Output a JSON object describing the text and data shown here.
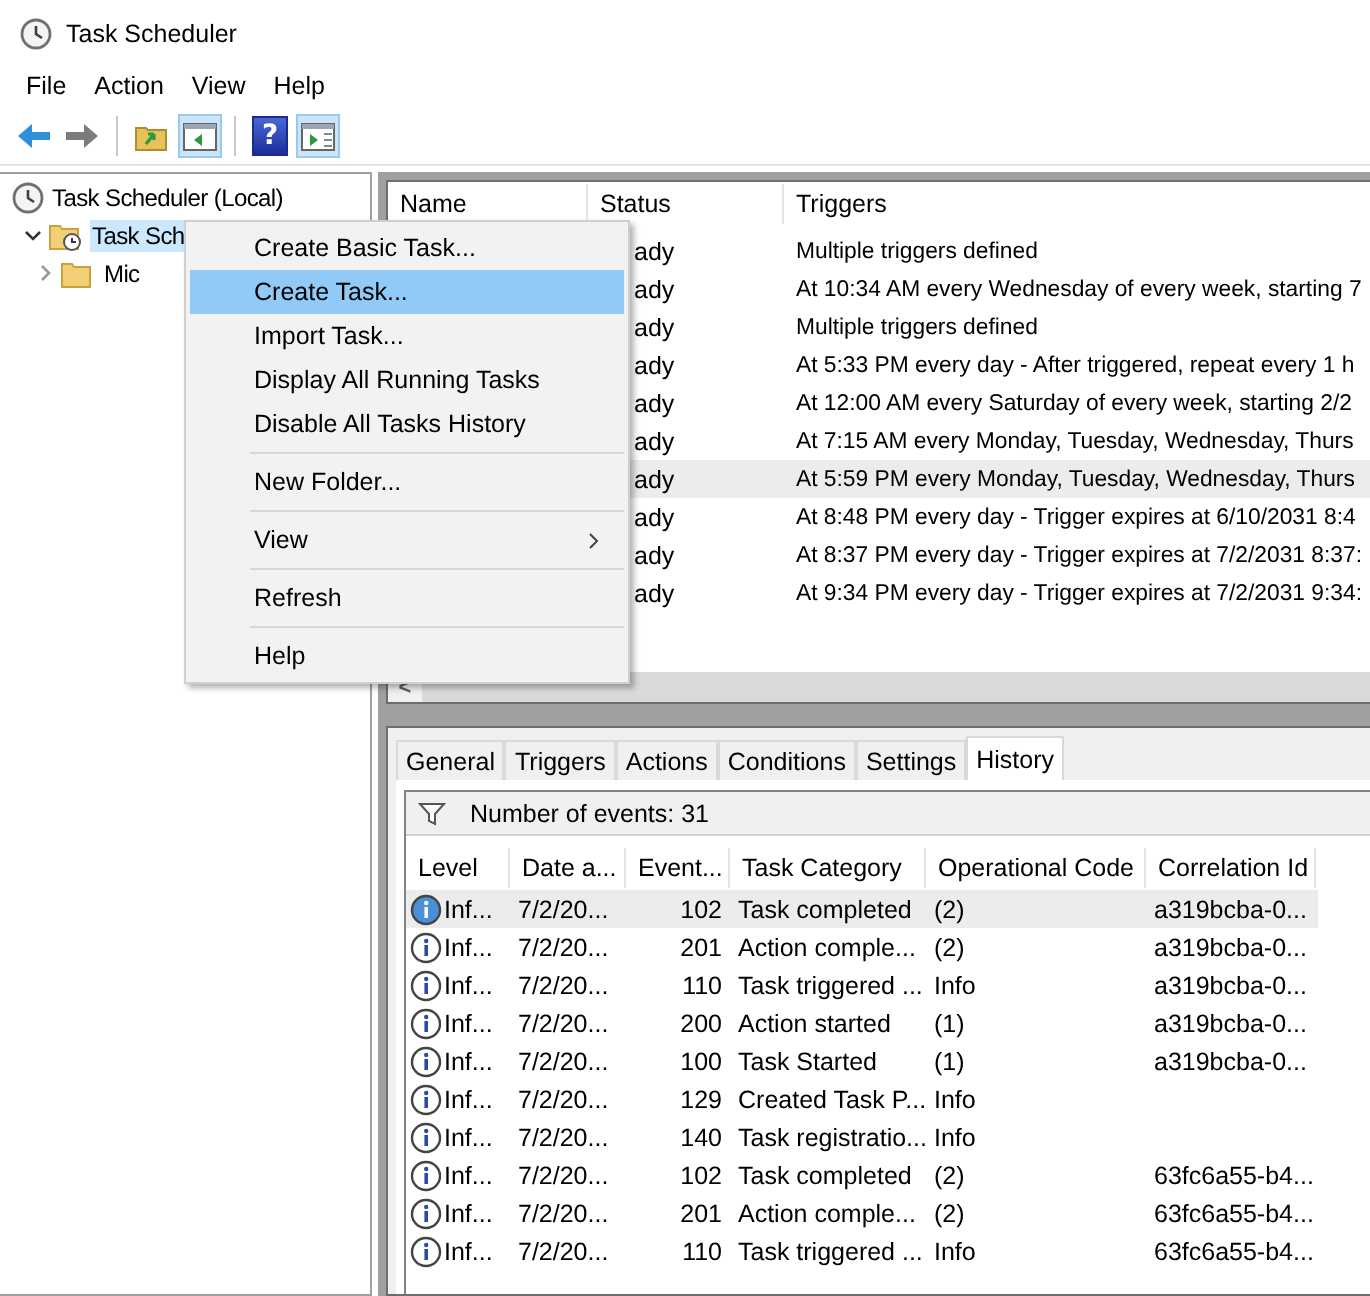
{
  "window": {
    "title": "Task Scheduler"
  },
  "menu": [
    "File",
    "Action",
    "View",
    "Help"
  ],
  "toolbar": [
    {
      "kind": "back",
      "pressed": false
    },
    {
      "kind": "forward",
      "pressed": false
    },
    {
      "kind": "sep"
    },
    {
      "kind": "up",
      "pressed": false
    },
    {
      "kind": "tree",
      "pressed": true
    },
    {
      "kind": "sep"
    },
    {
      "kind": "help",
      "label": "?",
      "pressed": false
    },
    {
      "kind": "pane",
      "pressed": true
    }
  ],
  "tree": [
    {
      "label": "Task Scheduler (Local)",
      "kind": "clock",
      "selected": false,
      "children": [
        {
          "label": "Task Sch",
          "kind": "clockfolder",
          "selected": true,
          "expanded": true,
          "children": [
            {
              "label": "Mic",
              "kind": "folder",
              "selected": false,
              "expanded": false
            }
          ]
        }
      ]
    }
  ],
  "context_menu": [
    {
      "label": "Create Basic Task...",
      "selected": false,
      "divider_before": false
    },
    {
      "label": "Create Task...",
      "selected": true,
      "divider_before": false
    },
    {
      "label": "Import Task...",
      "selected": false,
      "divider_before": false
    },
    {
      "label": "Display All Running Tasks",
      "selected": false,
      "divider_before": false
    },
    {
      "label": "Disable All Tasks History",
      "selected": false,
      "divider_before": false
    },
    {
      "label": "New Folder...",
      "selected": false,
      "divider_before": true
    },
    {
      "label": "View",
      "selected": false,
      "divider_before": true,
      "submenu": true
    },
    {
      "label": "Refresh",
      "selected": false,
      "divider_before": true
    },
    {
      "label": "Help",
      "selected": false,
      "divider_before": true
    }
  ],
  "tasks": {
    "columns": [
      "Name",
      "Status",
      "Triggers"
    ],
    "rows": [
      {
        "status": "ady",
        "triggers": "Multiple triggers defined",
        "selected": false
      },
      {
        "status": "ady",
        "triggers": "At 10:34 AM every Wednesday of every week, starting 7",
        "selected": false
      },
      {
        "status": "ady",
        "triggers": "Multiple triggers defined",
        "selected": false
      },
      {
        "status": "ady",
        "triggers": "At 5:33 PM every day - After triggered, repeat every 1 h",
        "selected": false
      },
      {
        "status": "ady",
        "triggers": "At 12:00 AM every Saturday of every week, starting 2/2",
        "selected": false
      },
      {
        "status": "ady",
        "triggers": "At 7:15 AM every Monday, Tuesday, Wednesday, Thurs",
        "selected": false
      },
      {
        "status": "ady",
        "triggers": "At 5:59 PM every Monday, Tuesday, Wednesday, Thurs",
        "selected": true
      },
      {
        "status": "ady",
        "triggers": "At 8:48 PM every day - Trigger expires at 6/10/2031 8:4",
        "selected": false
      },
      {
        "status": "ady",
        "triggers": "At 8:37 PM every day - Trigger expires at 7/2/2031 8:37:",
        "selected": false
      },
      {
        "status": "ady",
        "triggers": "At 9:34 PM every day - Trigger expires at 7/2/2031 9:34:",
        "selected": false
      }
    ]
  },
  "scroll_left": "<",
  "tabs": [
    {
      "label": "General",
      "selected": false
    },
    {
      "label": "Triggers",
      "selected": false
    },
    {
      "label": "Actions",
      "selected": false
    },
    {
      "label": "Conditions",
      "selected": false
    },
    {
      "label": "Settings",
      "selected": false
    },
    {
      "label": "History",
      "selected": true
    }
  ],
  "history": {
    "filter_label": "Number of events: 31",
    "columns": [
      "Level",
      "Date a...",
      "Event...",
      "Task Category",
      "Operational Code",
      "Correlation Id"
    ],
    "rows": [
      {
        "level": "Inf...",
        "date": "7/2/20...",
        "event": "102",
        "category": "Task completed",
        "opcode": "(2)",
        "correlation": "a319bcba-0...",
        "selected": true
      },
      {
        "level": "Inf...",
        "date": "7/2/20...",
        "event": "201",
        "category": "Action comple...",
        "opcode": "(2)",
        "correlation": "a319bcba-0...",
        "selected": false
      },
      {
        "level": "Inf...",
        "date": "7/2/20...",
        "event": "110",
        "category": "Task triggered ...",
        "opcode": "Info",
        "correlation": "a319bcba-0...",
        "selected": false
      },
      {
        "level": "Inf...",
        "date": "7/2/20...",
        "event": "200",
        "category": "Action started",
        "opcode": "(1)",
        "correlation": "a319bcba-0...",
        "selected": false
      },
      {
        "level": "Inf...",
        "date": "7/2/20...",
        "event": "100",
        "category": "Task Started",
        "opcode": "(1)",
        "correlation": "a319bcba-0...",
        "selected": false
      },
      {
        "level": "Inf...",
        "date": "7/2/20...",
        "event": "129",
        "category": "Created Task P...",
        "opcode": "Info",
        "selected": false
      },
      {
        "level": "Inf...",
        "date": "7/2/20...",
        "event": "140",
        "category": "Task registratio...",
        "opcode": "Info",
        "selected": false
      },
      {
        "level": "Inf...",
        "date": "7/2/20...",
        "event": "102",
        "category": "Task completed",
        "opcode": "(2)",
        "correlation": "63fc6a55-b4...",
        "selected": false
      },
      {
        "level": "Inf...",
        "date": "7/2/20...",
        "event": "201",
        "category": "Action comple...",
        "opcode": "(2)",
        "correlation": "63fc6a55-b4...",
        "selected": false
      },
      {
        "level": "Inf...",
        "date": "7/2/20...",
        "event": "110",
        "category": "Task triggered ...",
        "opcode": "Info",
        "correlation": "63fc6a55-b4...",
        "selected": false
      }
    ]
  }
}
